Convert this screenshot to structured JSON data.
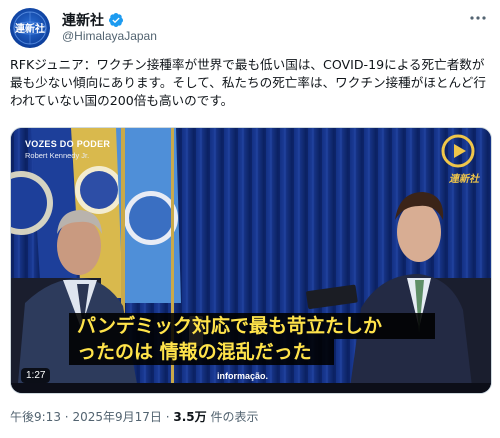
{
  "account": {
    "display_name": "連新社",
    "handle": "@HimalayaJapan",
    "avatar_text": "連新社",
    "verified": true
  },
  "tweet": {
    "text": "RFKジュニア：ワクチン接種率が世界で最も低い国は、COVID-19による死亡者数が最も少ない傾向にあります。そして、私たちの死亡率は、ワクチン接種がほとんど行われていない国の200倍も高いのです。"
  },
  "video": {
    "channel_title": "VOZES DO PODER",
    "channel_subtitle": "Robert Kennedy Jr.",
    "logo_text": "連新社",
    "subtitle_line1": "パンデミック対応で最も苛立たしか",
    "subtitle_line2": "ったのは 情報の混乱だった",
    "small_subtitle": "informação.",
    "duration": "1:27"
  },
  "meta": {
    "time": "午後9:13",
    "separator": "·",
    "date": "2025年9月17日",
    "views": "3.5万",
    "views_label": "件の表示"
  },
  "colors": {
    "verified_blue": "#1d9bf0",
    "subtitle_yellow": "#ffe34a",
    "muted_text": "#536471"
  }
}
